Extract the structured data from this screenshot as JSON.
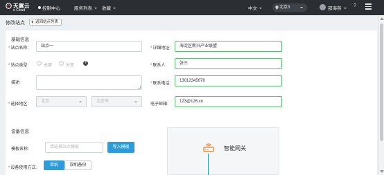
{
  "topbar": {
    "logo_cn": "天翼云",
    "logo_en": "e Cloud",
    "console": "控制中心",
    "nav": [
      {
        "label": "服务列表"
      },
      {
        "label": "收藏"
      }
    ],
    "lang": "中文",
    "region": "北京3",
    "user": "邵海燕",
    "help": "?"
  },
  "page": {
    "title": "修改站点",
    "back_label": "返回站点列表"
  },
  "basic": {
    "section": "基础信息",
    "site_name": {
      "label": "站点名称:",
      "value": "站点一"
    },
    "address": {
      "label": "详细地址:",
      "value": "海淀区新兴产业联盟"
    },
    "site_type": {
      "label": "站点类型:",
      "options": [
        "总部",
        "分支"
      ]
    },
    "contact": {
      "label": "联系人:",
      "value": "张三"
    },
    "description": {
      "label": "描述:",
      "value": ""
    },
    "phone": {
      "label": "联系电话:",
      "value": "13012345678"
    },
    "area": {
      "label": "选择地区:",
      "province": "北京",
      "city": "北京市"
    },
    "email": {
      "label": "电子邮箱:",
      "value": "123@126.cn"
    }
  },
  "device": {
    "section": "设备信息",
    "template": {
      "label": "模板名称:",
      "placeholder": "请选择站点模板",
      "import_label": "导入模板"
    },
    "mode": {
      "label": "设备使用方式:",
      "single": "单机",
      "dual": "双机备份"
    },
    "diagram_label": "智能网关"
  },
  "colors": {
    "topbar": "#2b2e33",
    "primary": "#2d9cdb",
    "valid_border": "#5bc06c",
    "required": "#e4393c"
  },
  "icons": [
    "tianyi-logo-icon",
    "location-pin-icon",
    "caret-down-icon",
    "hamburger-menu-icon",
    "question-icon",
    "gateway-router-icon"
  ]
}
